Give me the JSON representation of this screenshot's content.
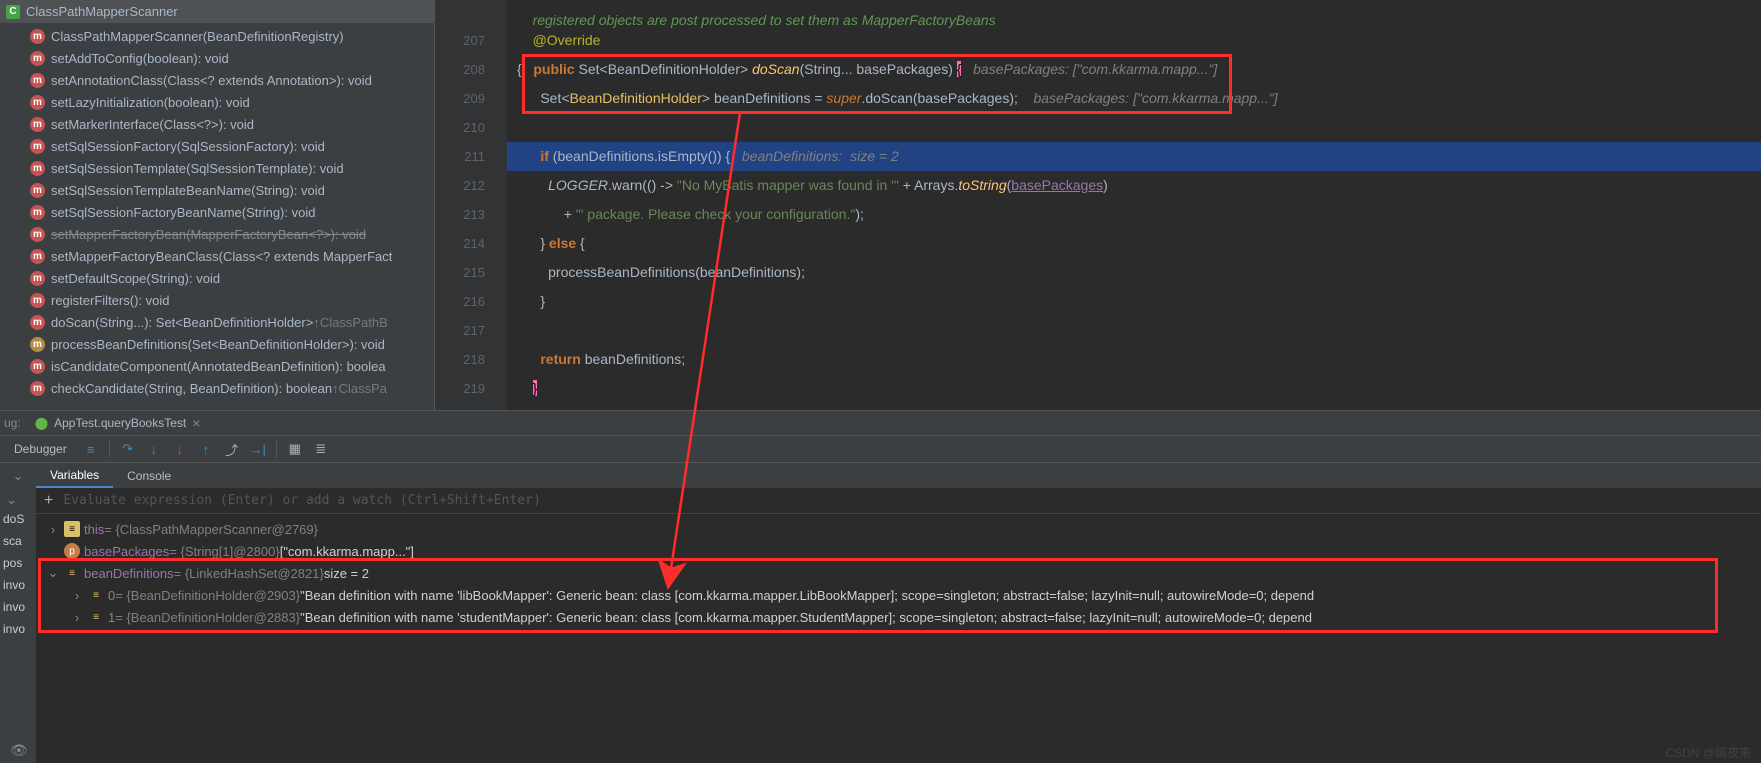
{
  "structure": {
    "className": "ClassPathMapperScanner",
    "members": [
      {
        "icon": "m",
        "label": "ClassPathMapperScanner(BeanDefinitionRegistry)"
      },
      {
        "icon": "m",
        "label": "setAddToConfig(boolean): void"
      },
      {
        "icon": "m",
        "label": "setAnnotationClass(Class<? extends Annotation>): void"
      },
      {
        "icon": "m",
        "label": "setLazyInitialization(boolean): void"
      },
      {
        "icon": "m",
        "label": "setMarkerInterface(Class<?>): void"
      },
      {
        "icon": "m",
        "label": "setSqlSessionFactory(SqlSessionFactory): void"
      },
      {
        "icon": "m",
        "label": "setSqlSessionTemplate(SqlSessionTemplate): void"
      },
      {
        "icon": "m",
        "label": "setSqlSessionTemplateBeanName(String): void"
      },
      {
        "icon": "m",
        "label": "setSqlSessionFactoryBeanName(String): void"
      },
      {
        "icon": "m",
        "label": "setMapperFactoryBean(MapperFactoryBean<?>): void",
        "strike": true
      },
      {
        "icon": "m",
        "label": "setMapperFactoryBeanClass(Class<? extends MapperFact"
      },
      {
        "icon": "m",
        "label": "setDefaultScope(String): void"
      },
      {
        "icon": "m",
        "label": "registerFilters(): void"
      },
      {
        "icon": "m",
        "label": "doScan(String...): Set<BeanDefinitionHolder> ",
        "inh": "↑ClassPathB"
      },
      {
        "icon": "lk",
        "label": "processBeanDefinitions(Set<BeanDefinitionHolder>): void"
      },
      {
        "icon": "m",
        "label": "isCandidateComponent(AnnotatedBeanDefinition): boolea"
      },
      {
        "icon": "m",
        "label": "checkCandidate(String, BeanDefinition): boolean ",
        "inh": "↑ClassPa"
      }
    ]
  },
  "code": {
    "docLine": "registered objects are post processed to set them as MapperFactoryBeans",
    "lines": [
      "207",
      "208",
      "209",
      "210",
      "211",
      "212",
      "213",
      "214",
      "215",
      "216",
      "217",
      "218",
      "219"
    ],
    "l207_ann": "@Override",
    "l208_kw1": "public",
    "l208_typ": "Set",
    "l208_gen": "BeanDefinitionHolder",
    "l208_meth": "doScan",
    "l208_p1": "String",
    "l208_p2": "basePackages",
    "l208_hint": "basePackages: [\"com.kkarma.mapp...\"]",
    "l209_typ": "Set",
    "l209_gen": "BeanDefinitionHolder",
    "l209_v": "beanDefinitions",
    "l209_sup": "super",
    "l209_m": "doScan",
    "l209_arg": "basePackages",
    "l209_hint": "basePackages: [\"com.kkarma.mapp...\"]",
    "l211_kw": "if",
    "l211_v": "beanDefinitions",
    "l211_m": "isEmpty",
    "l211_hint": "beanDefinitions:  size = 2",
    "l212_log": "LOGGER",
    "l212_warn": "warn",
    "l212_str": "\"No MyBatis mapper was found in '\"",
    "l212_arr": "Arrays",
    "l212_ts": "toString",
    "l212_bp": "basePackages",
    "l213_str": "\"' package. Please check your configuration.\"",
    "l214_else": "else",
    "l215_m": "processBeanDefinitions",
    "l215_arg": "beanDefinitions",
    "l218_kw": "return",
    "l218_v": "beanDefinitions"
  },
  "debug": {
    "label": "ug:",
    "tab": "AppTest.queryBooksTest",
    "debuggerLabel": "Debugger",
    "varTab": "Variables",
    "consoleTab": "Console",
    "evalHint": "Evaluate expression (Enter) or add a watch (Ctrl+Shift+Enter)",
    "frames": [
      "doS",
      "sca",
      "pos",
      "invo",
      "invo",
      "invo"
    ],
    "tree": {
      "this_nm": "this",
      "this_val": " = {ClassPathMapperScanner@2769}",
      "bp_nm": "basePackages",
      "bp_val": " = {String[1]@2800} ",
      "bp_str": "[\"com.kkarma.mapp...\"]",
      "bd_nm": "beanDefinitions",
      "bd_val": " = {LinkedHashSet@2821}  ",
      "bd_sz": "size = 2",
      "e0_nm": "0",
      "e0_cls": " = {BeanDefinitionHolder@2903} ",
      "e0_str": "\"Bean definition with name 'libBookMapper': Generic bean: class [com.kkarma.mapper.LibBookMapper]; scope=singleton; abstract=false; lazyInit=null; autowireMode=0; depend",
      "e1_nm": "1",
      "e1_cls": " = {BeanDefinitionHolder@2883} ",
      "e1_str": "\"Bean definition with name 'studentMapper': Generic bean: class [com.kkarma.mapper.StudentMapper]; scope=singleton; abstract=false; lazyInit=null; autowireMode=0; depend"
    }
  },
  "watermark": "CSDN @嫣夜来"
}
